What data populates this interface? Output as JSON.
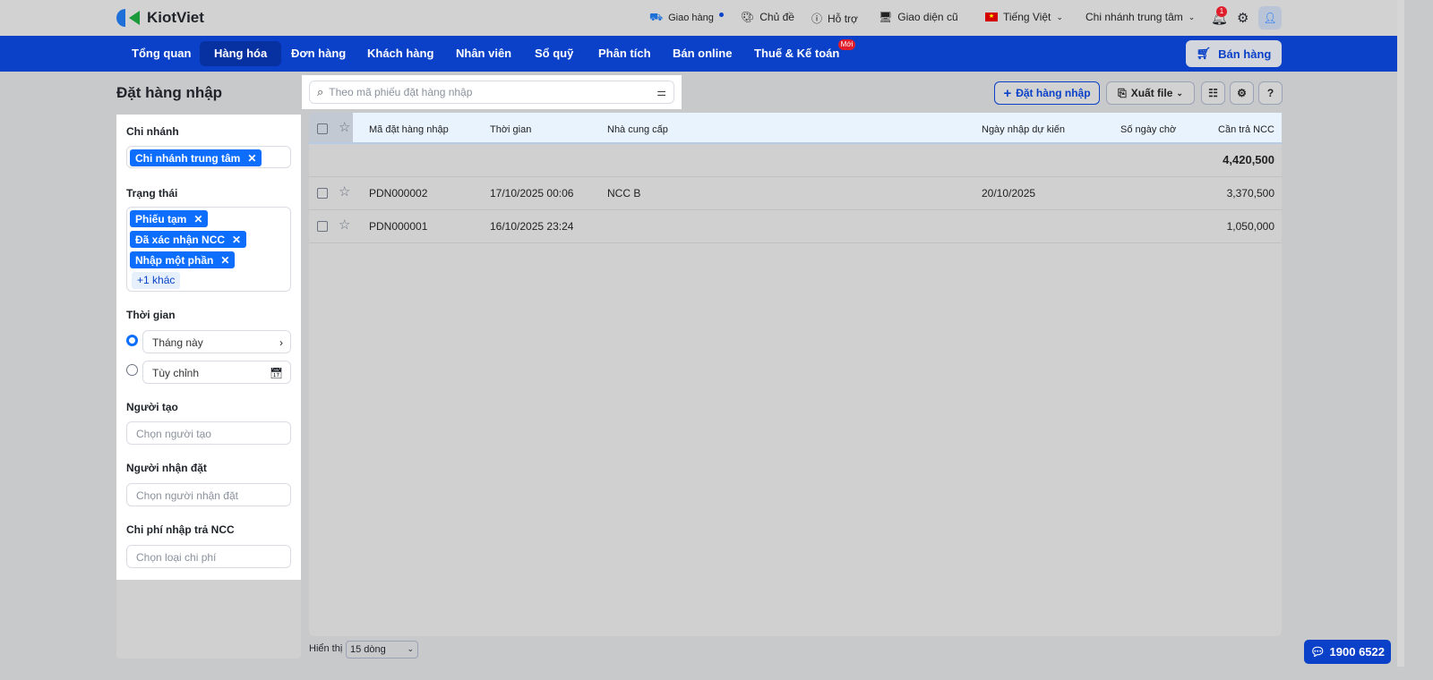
{
  "brand": "KiotViet",
  "topbar": {
    "delivery": "Giao hàng",
    "theme": "Chủ đề",
    "support": "Hỗ trợ",
    "old_ui": "Giao diện cũ",
    "language": "Tiếng Việt",
    "branch": "Chi nhánh trung tâm",
    "notif_count": "1"
  },
  "nav": {
    "items": [
      "Tổng quan",
      "Hàng hóa",
      "Đơn hàng",
      "Khách hàng",
      "Nhân viên",
      "Sổ quỹ",
      "Phân tích",
      "Bán online",
      "Thuế & Kế toán"
    ],
    "new_badge": "Mới",
    "sell_button": "Bán hàng"
  },
  "page": {
    "title": "Đặt hàng nhập",
    "search_placeholder": "Theo mã phiếu đặt hàng nhập",
    "add_button": "Đặt hàng nhập",
    "export_button": "Xuất file"
  },
  "filters": {
    "branch_label": "Chi nhánh",
    "branch_tags": [
      "Chi nhánh trung tâm"
    ],
    "status_label": "Trạng thái",
    "status_tags": [
      "Phiếu tạm",
      "Đã xác nhận NCC",
      "Nhập một phần"
    ],
    "status_more": "+1 khác",
    "time_label": "Thời gian",
    "time_option_1": "Tháng này",
    "time_option_2": "Tùy chỉnh",
    "creator_label": "Người tạo",
    "creator_placeholder": "Chọn người tạo",
    "receiver_label": "Người nhận đặt",
    "receiver_placeholder": "Chọn người nhận đặt",
    "cost_label": "Chi phí nhập trả NCC",
    "cost_placeholder": "Chọn loại chi phí"
  },
  "table": {
    "headers": [
      "Mã đặt hàng nhập",
      "Thời gian",
      "Nhà cung cấp",
      "Ngày nhập dự kiến",
      "Số ngày chờ",
      "Cần trả NCC"
    ],
    "total": "4,420,500",
    "rows": [
      {
        "code": "PDN000002",
        "time": "17/10/2025 00:06",
        "supplier": "NCC B",
        "expected": "20/10/2025",
        "wait": "",
        "due": "3,370,500"
      },
      {
        "code": "PDN000001",
        "time": "16/10/2025 23:24",
        "supplier": "",
        "expected": "",
        "wait": "",
        "due": "1,050,000"
      }
    ]
  },
  "footer": {
    "show_label": "Hiển thị",
    "page_size": "15 dòng",
    "hotline": "1900 6522"
  }
}
